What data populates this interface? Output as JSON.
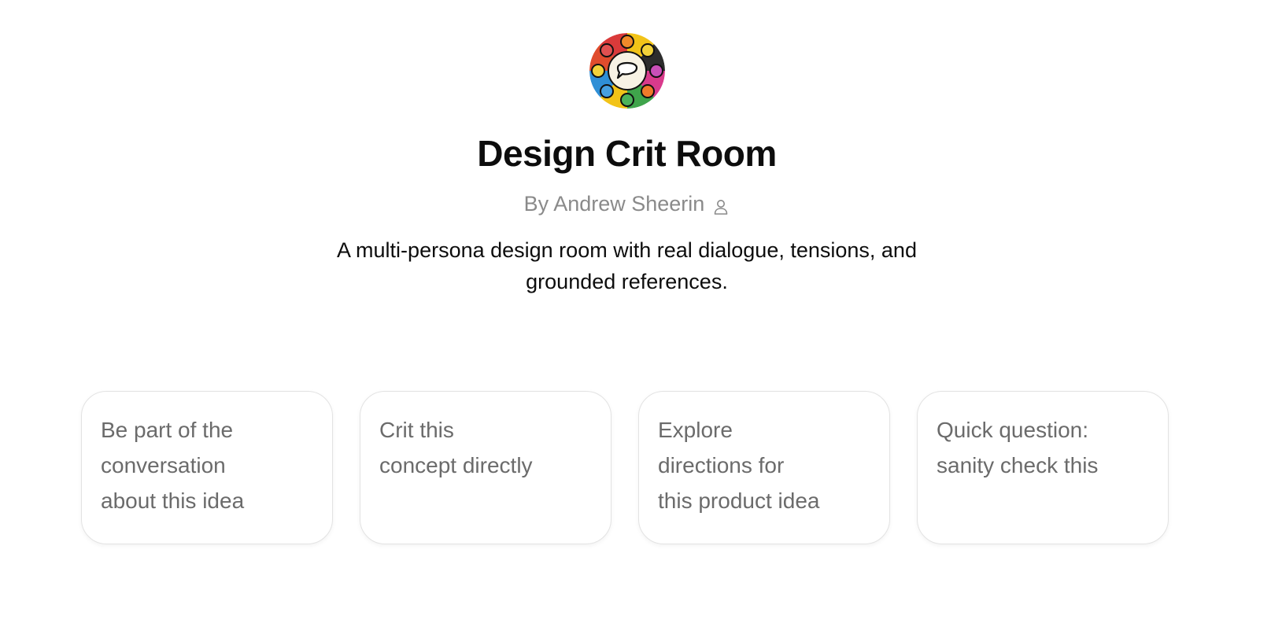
{
  "gpt": {
    "title": "Design Crit Room",
    "author_label": "By Andrew Sheerin",
    "description": "A multi-persona design room with real dialogue, tensions, and grounded references."
  },
  "conversation_starters": [
    {
      "label": "Be part of the\nconversation\nabout this idea"
    },
    {
      "label": "Crit this\nconcept directly"
    },
    {
      "label": "Explore\ndirections for\nthis product idea"
    },
    {
      "label": "Quick question:\nsanity check this"
    }
  ],
  "icons": {
    "avatar": "round-table-personas-logo",
    "author": "person-icon"
  },
  "colors": {
    "text_primary": "#0d0d0d",
    "text_secondary": "#8a8a8a",
    "card_text": "#6b6b6b",
    "card_border": "#e3e3e3"
  }
}
